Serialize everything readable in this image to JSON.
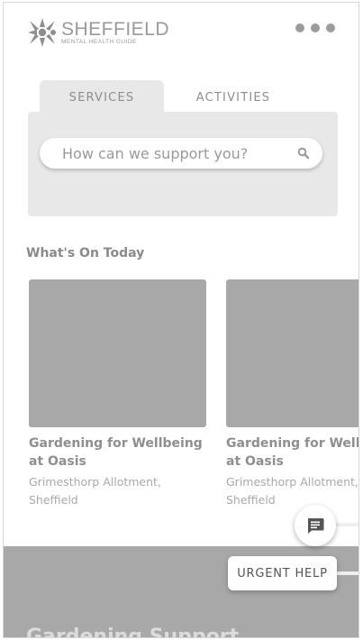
{
  "header": {
    "logo_name": "SHEFFIELD",
    "logo_subtitle": "MENTAL HEALTH GUIDE",
    "menu_icon": "more-horizontal-icon"
  },
  "tabs": [
    {
      "label": "SERVICES",
      "active": true
    },
    {
      "label": "ACTIVITIES",
      "active": false
    }
  ],
  "search": {
    "placeholder": "How can we support you?",
    "value": "",
    "icon": "search-icon"
  },
  "whats_on": {
    "title": "What's On Today",
    "cards": [
      {
        "title_line1": "Gardening for Wellbeing",
        "title_line2": "at Oasis",
        "location_line1": "Grimesthorp Allotment,",
        "location_line2": "Sheffield"
      },
      {
        "title_line1": "Gardening for Wellbeing",
        "title_line2": "at Oasis",
        "location_line1": "Grimesthorp Allotment,",
        "location_line2": "Sheffield"
      }
    ]
  },
  "bottom": {
    "heading": "Gardening Support"
  },
  "floating": {
    "chat_icon": "chat-icon",
    "urgent_label": "URGENT HELP"
  },
  "colors": {
    "panel": "#e8e8e8",
    "image_placeholder": "#a8a8a8",
    "text": "#8a8a8a"
  }
}
